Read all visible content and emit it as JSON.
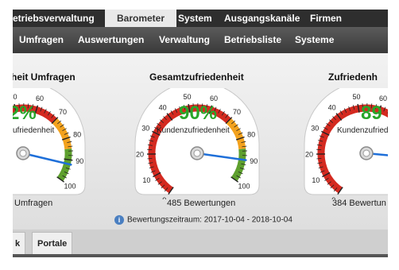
{
  "topnav": {
    "items": [
      "etriebsverwaltung",
      "Barometer",
      "System",
      "Ausgangskanäle",
      "Firmen"
    ],
    "active_index": 1
  },
  "subnav": {
    "items": [
      "Umfragen",
      "Auswertungen",
      "Verwaltung",
      "Betriebsliste",
      "Systeme"
    ]
  },
  "gauges": [
    {
      "title": "heit Umfragen",
      "value_text": "2%",
      "value": 92,
      "label": "ufriedenheit",
      "count_text": "Umfragen"
    },
    {
      "title": "Gesamtzufriedenheit",
      "value_text": "90%",
      "value": 90,
      "label": "Kundenzufriedenheit",
      "count_text": "485 Bewertungen"
    },
    {
      "title": "Zufriedenh",
      "value_text": "89",
      "value": 89,
      "label": "Kundenzufriedenh",
      "count_text": "384 Bewertun"
    }
  ],
  "scale_labels": [
    "0",
    "10",
    "20",
    "30",
    "40",
    "50",
    "60",
    "70",
    "80",
    "90",
    "100"
  ],
  "period_text": "Bewertungszeitraum: 2017-10-04 - 2018-10-04",
  "info_icon_text": "i",
  "tabs": [
    "k",
    "Portale"
  ],
  "colors": {
    "red": "#d42a20",
    "orange": "#f3a21e",
    "green": "#5ea02e",
    "needle": "#1e6fd9",
    "percent": "#2aa52a"
  }
}
